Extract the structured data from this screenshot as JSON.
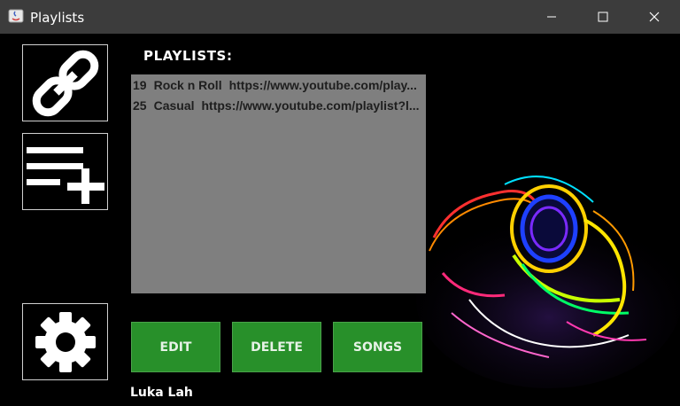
{
  "window": {
    "title": "Playlists"
  },
  "sidebar": [
    {
      "icon": "link-icon"
    },
    {
      "icon": "playlist-add-icon"
    },
    {
      "icon": "gear-icon"
    }
  ],
  "main": {
    "heading": "PLAYLISTS:",
    "playlists": [
      {
        "id": "19",
        "name": "Rock n Roll",
        "url": "https://www.youtube.com/play..."
      },
      {
        "id": "25",
        "name": "Casual",
        "url": "https://www.youtube.com/playlist?l..."
      }
    ]
  },
  "actions": {
    "edit": "EDIT",
    "delete": "DELETE",
    "songs": "SONGS"
  },
  "user": {
    "name": "Luka Lah"
  },
  "colors": {
    "titlebar": "#3c3c3c",
    "list_bg": "#7f7f7f",
    "button_green": "#28902a"
  }
}
